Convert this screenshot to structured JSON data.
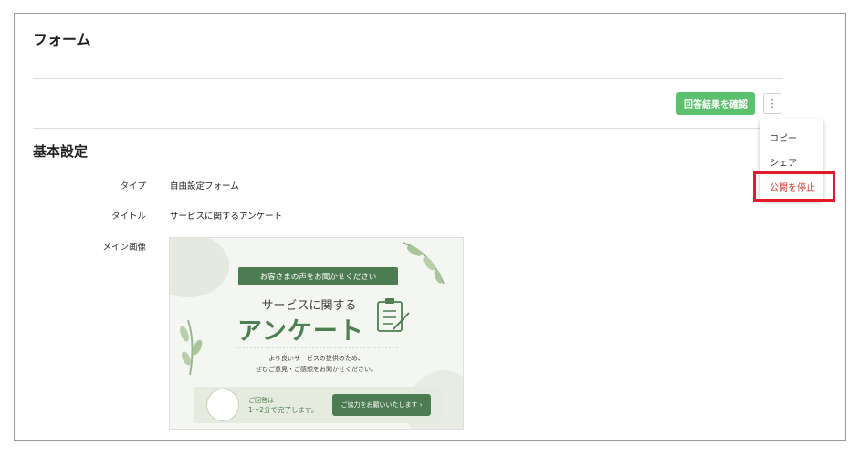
{
  "page": {
    "title": "フォーム"
  },
  "toolbar": {
    "results_label": "回答結果を確認",
    "more_label": "⋮"
  },
  "menu": {
    "items": [
      "コピー",
      "シェア",
      "公開を停止"
    ]
  },
  "section": {
    "title": "基本設定"
  },
  "fields": [
    {
      "label": "タイプ",
      "value": "自由設定フォーム"
    },
    {
      "label": "タイトル",
      "value": "サービスに関するアンケート"
    },
    {
      "label": "メイン画像",
      "value": ""
    }
  ],
  "banner": {
    "ribbon": "お客さまの声をお聞かせください",
    "subtitle": "サービスに関する",
    "main": "アンケート",
    "desc_line1": "より良いサービスの提供のため、",
    "desc_line2": "ぜひご意見・ご感想をお聞かせください。",
    "note_line1": "ご回答は",
    "note_line2": "1〜2分で完了します。",
    "cta": "ご協力をお願いいたします ›"
  },
  "colors": {
    "accent_green": "#5cc16f",
    "banner_green": "#4d7c52",
    "danger": "#d0392f",
    "highlight": "#e31a2a"
  }
}
